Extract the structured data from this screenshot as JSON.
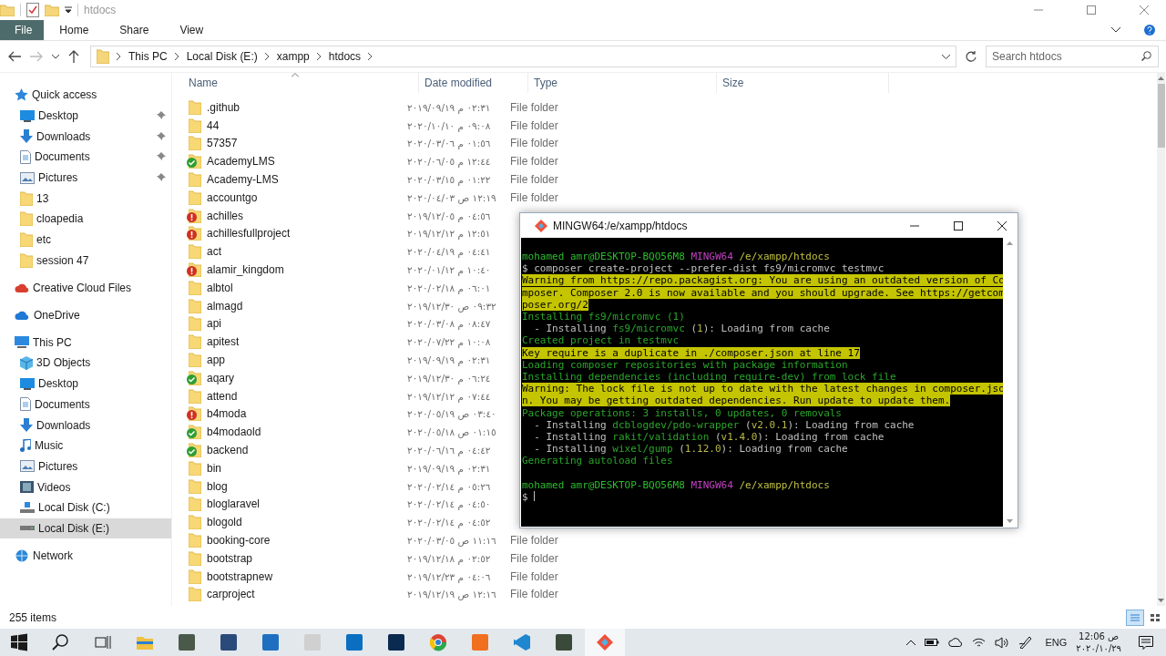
{
  "window": {
    "title": "htdocs"
  },
  "ribbon": {
    "tabs": [
      {
        "label": "File",
        "selected": true
      },
      {
        "label": "Home",
        "selected": false
      },
      {
        "label": "Share",
        "selected": false
      },
      {
        "label": "View",
        "selected": false
      }
    ]
  },
  "address_bar": {
    "crumbs": [
      "This PC",
      "Local Disk (E:)",
      "xampp",
      "htdocs"
    ]
  },
  "search": {
    "placeholder": "Search htdocs"
  },
  "sidebar": {
    "items": [
      {
        "label": "Quick access",
        "kind": "star",
        "selected": false,
        "children": [
          {
            "label": "Desktop",
            "kind": "desktop",
            "pinned": true,
            "selected": false
          },
          {
            "label": "Downloads",
            "kind": "download",
            "pinned": true,
            "selected": false
          },
          {
            "label": "Documents",
            "kind": "documents",
            "pinned": true,
            "selected": false
          },
          {
            "label": "Pictures",
            "kind": "pictures",
            "pinned": true,
            "selected": false
          },
          {
            "label": "13",
            "kind": "folder",
            "pinned": false,
            "selected": false
          },
          {
            "label": "cloapedia",
            "kind": "folder",
            "pinned": false,
            "selected": false
          },
          {
            "label": "etc",
            "kind": "folder",
            "pinned": false,
            "selected": false
          },
          {
            "label": "session 47",
            "kind": "folder",
            "pinned": false,
            "selected": false
          }
        ]
      },
      {
        "label": "Creative Cloud Files",
        "kind": "creative-cloud",
        "selected": false
      },
      {
        "label": "OneDrive",
        "kind": "cloud",
        "selected": false
      },
      {
        "label": "This PC",
        "kind": "pc",
        "selected": false,
        "children": [
          {
            "label": "3D Objects",
            "kind": "cube",
            "selected": false
          },
          {
            "label": "Desktop",
            "kind": "desktop",
            "selected": false
          },
          {
            "label": "Documents",
            "kind": "documents",
            "selected": false
          },
          {
            "label": "Downloads",
            "kind": "download",
            "selected": false
          },
          {
            "label": "Music",
            "kind": "music",
            "selected": false
          },
          {
            "label": "Pictures",
            "kind": "pictures",
            "selected": false
          },
          {
            "label": "Videos",
            "kind": "videos",
            "selected": false
          },
          {
            "label": "Local Disk (C:)",
            "kind": "system-drive",
            "selected": false
          },
          {
            "label": "Local Disk (E:)",
            "kind": "drive",
            "selected": true
          }
        ]
      },
      {
        "label": "Network",
        "kind": "network",
        "selected": false
      }
    ]
  },
  "file_list": {
    "columns": [
      "Name",
      "Date modified",
      "Type",
      "Size"
    ],
    "rows": [
      {
        "name": ".github",
        "date": "٠٢:٣١ م ٢٠١٩/٠٩/١٩",
        "type": "File folder"
      },
      {
        "name": "44",
        "date": "٠٩:٠٨ م ٢٠٢٠/١٠/١٠",
        "type": "File folder"
      },
      {
        "name": "57357",
        "date": "٠١:٥٦ م ٢٠٢٠/٠٣/٠٦",
        "type": "File folder"
      },
      {
        "name": "AcademyLMS",
        "date": "١٢:٤٤ م ٢٠٢٠/٠٦/٠٥",
        "type": "File folder",
        "kind": "synced"
      },
      {
        "name": "Academy-LMS",
        "date": "٠١:٢٢ م ٢٠٢٠/٠٣/١٥",
        "type": "File folder"
      },
      {
        "name": "accountgo",
        "date": "١٢:١٩ ص ٢٠٢٠/٠٤/٠٣",
        "type": "File folder"
      },
      {
        "name": "achilles",
        "date": "٠٤:٥٦ م ٢٠١٩/١٢/٠٥",
        "kind": "error"
      },
      {
        "name": "achillesfullproject",
        "date": "١٢:٥١ م ٢٠١٩/١٢/١٢",
        "kind": "error"
      },
      {
        "name": "act",
        "date": "٠٤:٤١ م ٢٠٢٠/٠٤/١٩"
      },
      {
        "name": "alamir_kingdom",
        "date": "١٠:٤٠ م ٢٠٢٠/٠١/١٢",
        "kind": "error"
      },
      {
        "name": "albtol",
        "date": "٠٦:٠١ م ٢٠٢٠/٠٢/١٨"
      },
      {
        "name": "almagd",
        "date": "٠٩:٣٢ ص ٢٠١٩/١٢/٣٠"
      },
      {
        "name": "api",
        "date": "٠٨:٤٧ م ٢٠٢٠/٠٣/٠٨"
      },
      {
        "name": "apitest",
        "date": "١٠:٠٨ م ٢٠٢٠/٠٧/٢٢"
      },
      {
        "name": "app",
        "date": "٠٢:٣١ م ٢٠١٩/٠٩/١٩"
      },
      {
        "name": "aqary",
        "date": "٠٦:٢٤ م ٢٠١٩/١٢/٣٠",
        "kind": "synced"
      },
      {
        "name": "attend",
        "date": "٠٧:٤٤ م ٢٠١٩/١٢/١٢"
      },
      {
        "name": "b4moda",
        "date": "٠٣:٤٠ ص ٢٠٢٠/٠٥/١٩",
        "kind": "error"
      },
      {
        "name": "b4modaold",
        "date": "٠١:١٥ ص ٢٠٢٠/٠٥/١٨",
        "kind": "synced"
      },
      {
        "name": "backend",
        "date": "٠٤:٤٢ م ٢٠٢٠/٠٦/١٦",
        "kind": "synced"
      },
      {
        "name": "bin",
        "date": "٠٢:٣١ م ٢٠١٩/٠٩/١٩"
      },
      {
        "name": "blog",
        "date": "٠٥:٢٦ م ٢٠٢٠/٠٢/١٤"
      },
      {
        "name": "bloglaravel",
        "date": "٠٤:٥٠ م ٢٠٢٠/٠٢/١٤"
      },
      {
        "name": "blogold",
        "date": "٠٤:٥٢ م ٢٠٢٠/٠٢/١٤"
      },
      {
        "name": "booking-core",
        "date": "١١:١٦ ص ٢٠٢٠/٠٣/٠٥",
        "type": "File folder"
      },
      {
        "name": "bootstrap",
        "date": "٠٢:٥٢ م ٢٠١٩/١٢/١٨",
        "type": "File folder"
      },
      {
        "name": "bootstrapnew",
        "date": "٠٤:٠٦ م ٢٠١٩/١٢/٢٣",
        "type": "File folder"
      },
      {
        "name": "carproject",
        "date": "١٢:١٦ ص ٢٠١٩/١٢/١٩",
        "type": "File folder"
      }
    ]
  },
  "status_bar": {
    "item_count": "255 items"
  },
  "terminal": {
    "title": "MINGW64:/e/xampp/htdocs",
    "blocks": [
      {
        "prompt": {
          "user": "mohamed amr@DESKTOP-BQO56M8",
          "host": "MINGW64",
          "path": "/e/xampp/htdocs"
        },
        "command": "$ composer create-project --prefer-dist fs9/micromvc testmvc",
        "output": [
          {
            "segments": [
              {
                "kind": "warn",
                "text": "Warning from https://repo.packagist.org: You are using an outdated version of Co"
              }
            ]
          },
          {
            "segments": [
              {
                "kind": "warn",
                "text": "mposer. Composer 2.0 is now available and you should upgrade. See https://getcom"
              }
            ]
          },
          {
            "segments": [
              {
                "kind": "warn",
                "text": "poser.org/2"
              }
            ]
          },
          {
            "segments": [
              {
                "kind": "info",
                "text": "Installing fs9/micromvc (1)"
              }
            ]
          },
          {
            "segments": [
              {
                "kind": "plain",
                "text": "  - Installing "
              },
              {
                "kind": "info",
                "text": "fs9/micromvc"
              },
              {
                "kind": "plain",
                "text": " ("
              },
              {
                "kind": "version",
                "text": "1"
              },
              {
                "kind": "plain",
                "text": "): Loading from cache"
              }
            ]
          },
          {
            "segments": [
              {
                "kind": "info",
                "text": "Created project in testmvc"
              }
            ]
          },
          {
            "segments": [
              {
                "kind": "warn",
                "text": "Key require is a duplicate in ./composer.json at line 17"
              }
            ]
          },
          {
            "segments": [
              {
                "kind": "info",
                "text": "Loading composer repositories with package information"
              }
            ]
          },
          {
            "segments": [
              {
                "kind": "info",
                "text": "Installing dependencies (including require-dev) from lock file"
              }
            ]
          },
          {
            "segments": [
              {
                "kind": "warn",
                "text": "Warning: The lock file is not up to date with the latest changes in composer.jso"
              }
            ]
          },
          {
            "segments": [
              {
                "kind": "warn",
                "text": "n. You may be getting outdated dependencies. Run update to update them."
              }
            ]
          },
          {
            "segments": [
              {
                "kind": "info",
                "text": "Package operations: 3 installs, 0 updates, 0 removals"
              }
            ]
          },
          {
            "segments": [
              {
                "kind": "plain",
                "text": "  - Installing "
              },
              {
                "kind": "info",
                "text": "dcblogdev/pdo-wrapper"
              },
              {
                "kind": "plain",
                "text": " ("
              },
              {
                "kind": "version",
                "text": "v2.0.1"
              },
              {
                "kind": "plain",
                "text": "): Loading from cache"
              }
            ]
          },
          {
            "segments": [
              {
                "kind": "plain",
                "text": "  - Installing "
              },
              {
                "kind": "info",
                "text": "rakit/validation"
              },
              {
                "kind": "plain",
                "text": " ("
              },
              {
                "kind": "version",
                "text": "v1.4.0"
              },
              {
                "kind": "plain",
                "text": "): Loading from cache"
              }
            ]
          },
          {
            "segments": [
              {
                "kind": "plain",
                "text": "  - Installing "
              },
              {
                "kind": "info",
                "text": "wixel/gump"
              },
              {
                "kind": "plain",
                "text": " ("
              },
              {
                "kind": "version",
                "text": "1.12.0"
              },
              {
                "kind": "plain",
                "text": "): Loading from cache"
              }
            ]
          },
          {
            "segments": [
              {
                "kind": "info",
                "text": "Generating autoload files"
              }
            ]
          }
        ]
      },
      {
        "prompt": {
          "user": "mohamed amr@DESKTOP-BQO56M8",
          "host": "MINGW64",
          "path": "/e/xampp/htdocs"
        },
        "command": "$ "
      }
    ]
  },
  "taskbar": {
    "language": "ENG",
    "time": "12:06 ص",
    "date": "٢٠٢٠/١٠/٢٩"
  }
}
